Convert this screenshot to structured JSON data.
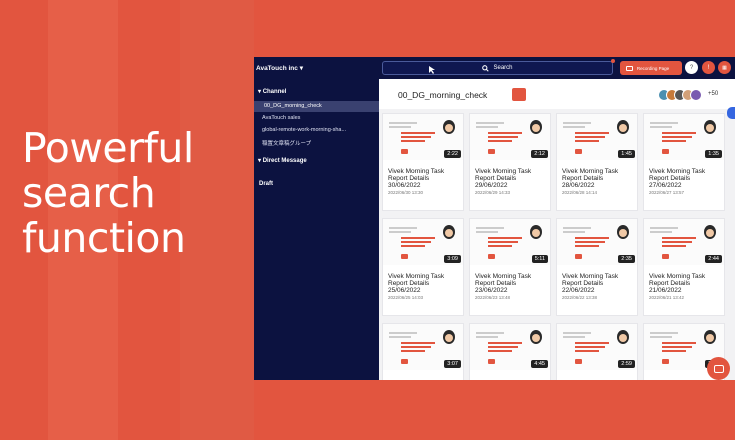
{
  "headline": [
    "Powerful",
    "search",
    "function"
  ],
  "workspace": {
    "name": "AvaTouch inc"
  },
  "sidebar": {
    "channel_header": "Channel",
    "channels": [
      "00_DG_morning_check",
      "AvaTouch sales",
      "global-remote-work-morning-sha...",
      "稲置文章稿グループ"
    ],
    "active_channel_index": 0,
    "dm_header": "Direct Message",
    "draft": "Draft"
  },
  "topbar": {
    "search_label": "Search",
    "record_label": "Recording Page"
  },
  "channel": {
    "name": "00_DG_morning_check",
    "member_overflow": "+50"
  },
  "cards": [
    {
      "title": "Vivek Morning Task",
      "subtitle": "Report Details",
      "date_line": "30/06/2022",
      "timestamp": "2022/06/30 13:30",
      "duration": "2:22"
    },
    {
      "title": "Vivek Morning Task",
      "subtitle": "Report Details",
      "date_line": "29/06/2022",
      "timestamp": "2022/06/29 14:33",
      "duration": "2:12"
    },
    {
      "title": "Vivek Morning Task",
      "subtitle": "Report Details",
      "date_line": "28/06/2022",
      "timestamp": "2022/06/28 14:14",
      "duration": "1:45"
    },
    {
      "title": "Vivek Morning Task",
      "subtitle": "Report Details",
      "date_line": "27/06/2022",
      "timestamp": "2022/06/27 13:57",
      "duration": "1:35"
    },
    {
      "title": "Vivek Morning Task",
      "subtitle": "Report Details",
      "date_line": "25/06/2022",
      "timestamp": "2022/06/25 14:03",
      "duration": "3:09"
    },
    {
      "title": "Vivek Morning Task",
      "subtitle": "Report Details",
      "date_line": "23/06/2022",
      "timestamp": "2022/06/23 13:48",
      "duration": "5:11"
    },
    {
      "title": "Vivek Morning Task",
      "subtitle": "Report Details",
      "date_line": "22/06/2022",
      "timestamp": "2022/06/22 13:38",
      "duration": "2:35"
    },
    {
      "title": "Vivek Morning Task",
      "subtitle": "Report Details",
      "date_line": "21/06/2022",
      "timestamp": "2022/06/21 13:42",
      "duration": "2:44"
    },
    {
      "title": "",
      "subtitle": "",
      "date_line": "",
      "timestamp": "",
      "duration": "3:07"
    },
    {
      "title": "",
      "subtitle": "",
      "date_line": "",
      "timestamp": "",
      "duration": "4:45"
    },
    {
      "title": "",
      "subtitle": "",
      "date_line": "",
      "timestamp": "",
      "duration": "2:59"
    },
    {
      "title": "",
      "subtitle": "",
      "date_line": "",
      "timestamp": "",
      "duration": "2:25"
    }
  ],
  "thumb_text": "What did you do yesterday and three details of achievement?",
  "colors": {
    "accent": "#e2553f",
    "navy": "#0c1240",
    "background": "#e2553f"
  },
  "icons": [
    "search-icon",
    "cursor-icon",
    "camera-icon",
    "question-icon",
    "notification-icon",
    "folder-icon",
    "chat-bubble-icon",
    "chevron-down-icon"
  ]
}
